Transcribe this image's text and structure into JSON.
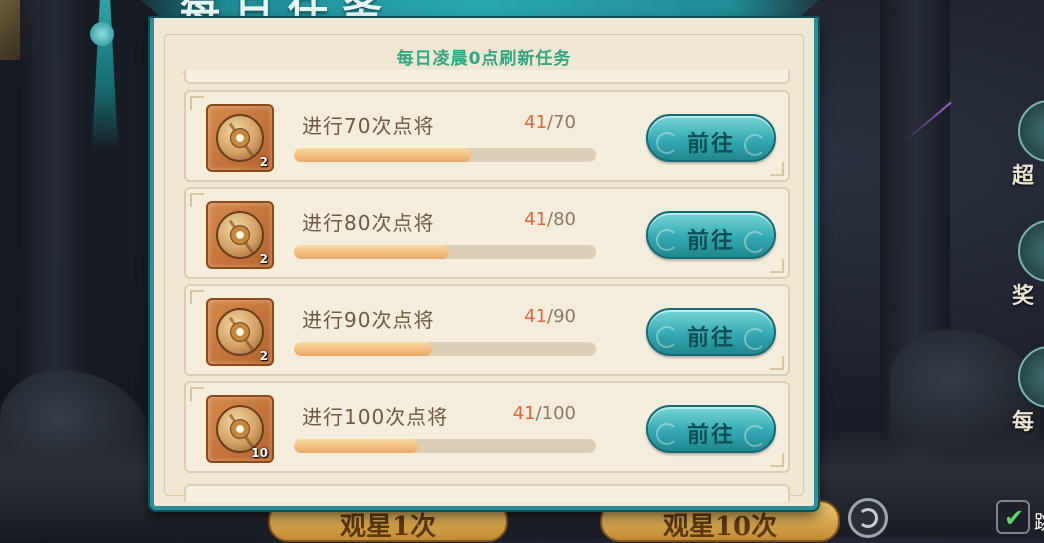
{
  "title": "每日任务",
  "subtitle": "每日凌晨0点刷新任务",
  "action_label": "前往",
  "colors": {
    "accent_teal": "#2c8f96",
    "subtitle_green": "#34a683",
    "progress_current": "#e0653f",
    "panel_bg": "#efe6d3"
  },
  "tasks": [
    {
      "name": "进行70次点将",
      "current": "41",
      "total": "/70",
      "progress": 0.5857,
      "reward_icon": "coin-icon",
      "reward_count": "2"
    },
    {
      "name": "进行80次点将",
      "current": "41",
      "total": "/80",
      "progress": 0.5125,
      "reward_icon": "coin-icon",
      "reward_count": "2"
    },
    {
      "name": "进行90次点将",
      "current": "41",
      "total": "/90",
      "progress": 0.4556,
      "reward_icon": "coin-icon",
      "reward_count": "2"
    },
    {
      "name": "进行100次点将",
      "current": "41",
      "total": "/100",
      "progress": 0.41,
      "reward_icon": "coin-icon",
      "reward_count": "10"
    }
  ],
  "bottom_buttons": [
    "观星1次",
    "观星10次"
  ],
  "side_menu": [
    "超",
    "奖",
    "每"
  ],
  "skip_label": "跳"
}
